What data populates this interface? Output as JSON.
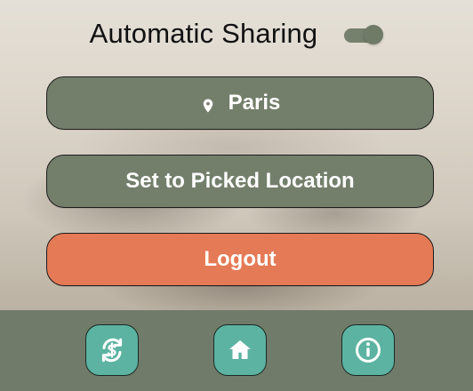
{
  "sharing": {
    "label": "Automatic Sharing",
    "enabled": true
  },
  "buttons": {
    "location_label": "Paris",
    "picked_label": "Set to Picked Location",
    "logout_label": "Logout"
  },
  "icons": {
    "location": "location-pin-icon",
    "sync": "sync-currency-icon",
    "home": "home-icon",
    "info": "info-icon"
  },
  "colors": {
    "primary_button": "#737f6b",
    "logout_button": "#e57a56",
    "nav_button": "#5cb3a2",
    "bottom_bar": "#707c69",
    "toggle": "#6f7a67"
  }
}
